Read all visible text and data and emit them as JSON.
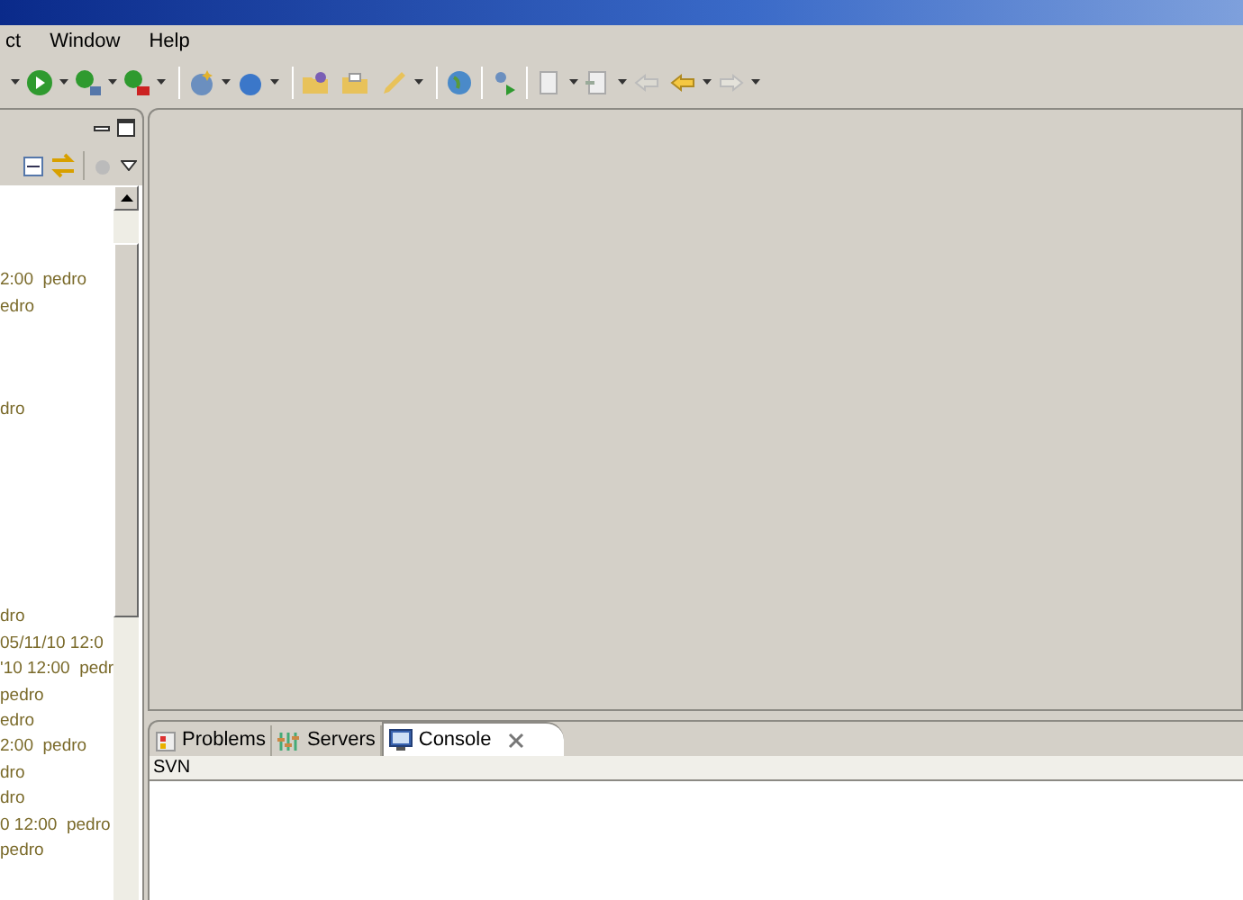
{
  "menu": [
    "ct",
    "Window",
    "Help"
  ],
  "tree": {
    "rows": [
      {
        "text": "2:00  pedro"
      },
      {
        "text": "edro"
      },
      {
        "text": "dro"
      },
      {
        "text": "dro"
      },
      {
        "text": "05/11/10 12:0"
      },
      {
        "text": "'10 12:00  pedr"
      },
      {
        "text": "pedro"
      },
      {
        "text": "edro"
      },
      {
        "text": "2:00  pedro"
      },
      {
        "text": "dro"
      },
      {
        "text": "dro"
      },
      {
        "text": "0 12:00  pedro"
      },
      {
        "text": "pedro"
      }
    ]
  },
  "bottom_panel": {
    "tabs": [
      {
        "label": "Problems",
        "kind": "problems",
        "selected": false
      },
      {
        "label": "Servers",
        "kind": "servers",
        "selected": false
      },
      {
        "label": "Console",
        "kind": "console",
        "selected": true
      }
    ],
    "console_title": "SVN"
  }
}
